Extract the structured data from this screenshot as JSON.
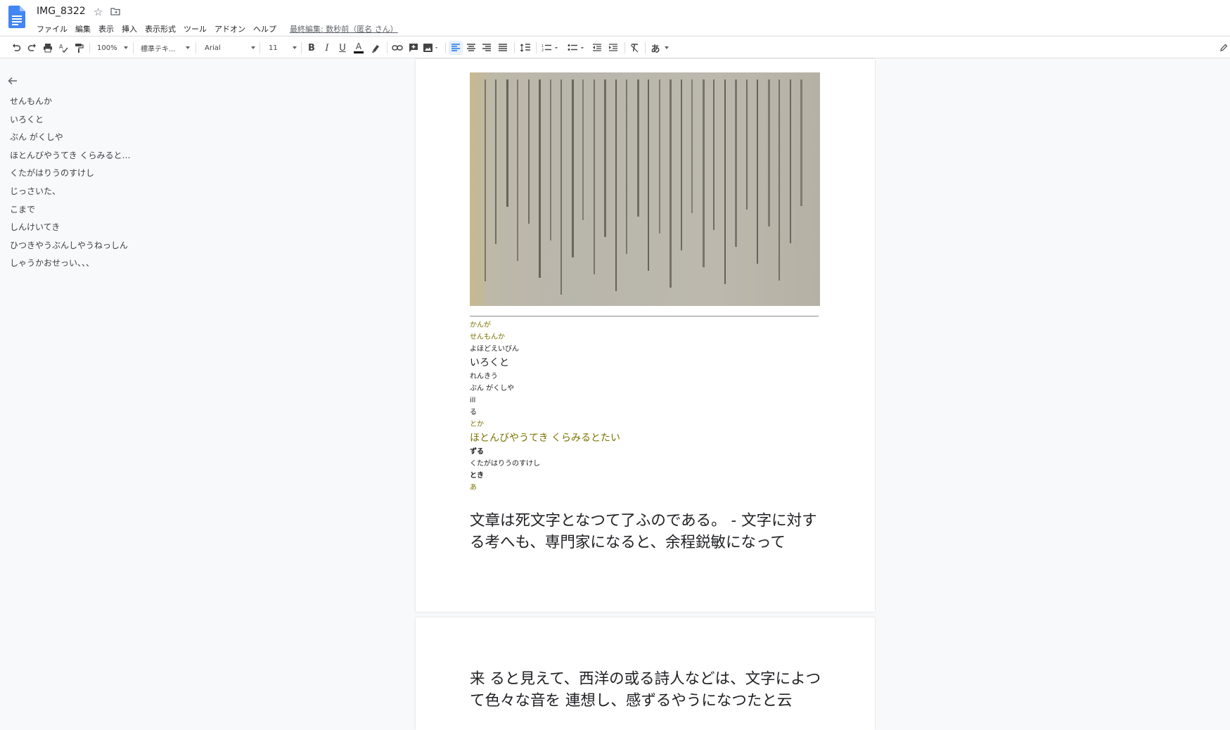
{
  "colors": {
    "accent": "#4285f4",
    "olive": "#7a7300",
    "text": "#202124"
  },
  "header": {
    "title": "IMG_8322",
    "menu": [
      "ファイル",
      "編集",
      "表示",
      "挿入",
      "表示形式",
      "ツール",
      "アドオン",
      "ヘルプ"
    ],
    "last_edit": "最終編集: 数秒前（匿名 さん）"
  },
  "toolbar": {
    "zoom": "100%",
    "style": "標準テキ...",
    "font": "Arial",
    "size": "11",
    "bold": "B",
    "italic": "I",
    "underline": "U",
    "text_color": "A",
    "input_tools": "あ",
    "icons": [
      "undo-icon",
      "redo-icon",
      "print-icon",
      "spellcheck-icon",
      "paint-format-icon",
      "link-icon",
      "comment-icon",
      "image-icon",
      "align-left-icon",
      "align-center-icon",
      "align-right-icon",
      "justify-icon",
      "line-spacing-icon",
      "numbered-list-icon",
      "bulleted-list-icon",
      "decrease-indent-icon",
      "increase-indent-icon",
      "clear-format-icon",
      "edit-mode-icon"
    ]
  },
  "outline": {
    "items": [
      "せんもんか",
      "いろくと",
      "ぶん がくしや",
      "ほとんびやうてき くらみると…",
      "くたがはりうのすけし",
      "じっさいた、",
      "こまで",
      "しんけいてき",
      "ひつきやうぶんしやうねっしん",
      "しゃうかおせっい、、、"
    ]
  },
  "document": {
    "lines": [
      {
        "text": "かんが",
        "size": 10,
        "color": "#7a7300",
        "h": 17,
        "bold": false
      },
      {
        "text": "せんもんか",
        "size": 10,
        "color": "#7a7300",
        "h": 17,
        "bold": false
      },
      {
        "text": "よほどえいびん",
        "size": 10,
        "color": "#202124",
        "h": 17,
        "bold": false
      },
      {
        "text": "いろくと",
        "size": 14,
        "color": "#202124",
        "h": 22,
        "bold": false
      },
      {
        "text": "れんきう",
        "size": 10,
        "color": "#202124",
        "h": 17,
        "bold": false
      },
      {
        "text": "ぶん がくしや",
        "size": 10,
        "color": "#202124",
        "h": 17,
        "bold": false
      },
      {
        "text": "ill",
        "size": 10,
        "color": "#202124",
        "h": 17,
        "bold": false
      },
      {
        "text": "る",
        "size": 10,
        "color": "#202124",
        "h": 17,
        "bold": false
      },
      {
        "text": "とか",
        "size": 10,
        "color": "#7a7300",
        "h": 17,
        "bold": false
      },
      {
        "text": "ほとんびやうてき くらみるとたい",
        "size": 14,
        "color": "#7a7300",
        "h": 22,
        "bold": false
      },
      {
        "text": "ずる",
        "size": 10,
        "color": "#202124",
        "h": 17,
        "bold": true
      },
      {
        "text": "くたがはりうのすけし",
        "size": 10,
        "color": "#202124",
        "h": 17,
        "bold": false
      },
      {
        "text": "とき",
        "size": 10,
        "color": "#202124",
        "h": 17,
        "bold": true
      },
      {
        "text": "あ",
        "size": 10,
        "color": "#7a7300",
        "h": 17,
        "bold": false
      }
    ],
    "main_p1": "文章は死文字となつて了ふのである。 - 文字に対する考へも、専門家になると、余程鋭敏になって",
    "main_p2": "来 ると見えて、西洋の或る詩人などは、文字によつて色々な音を 連想し、感ずるやうになつたと云"
  }
}
